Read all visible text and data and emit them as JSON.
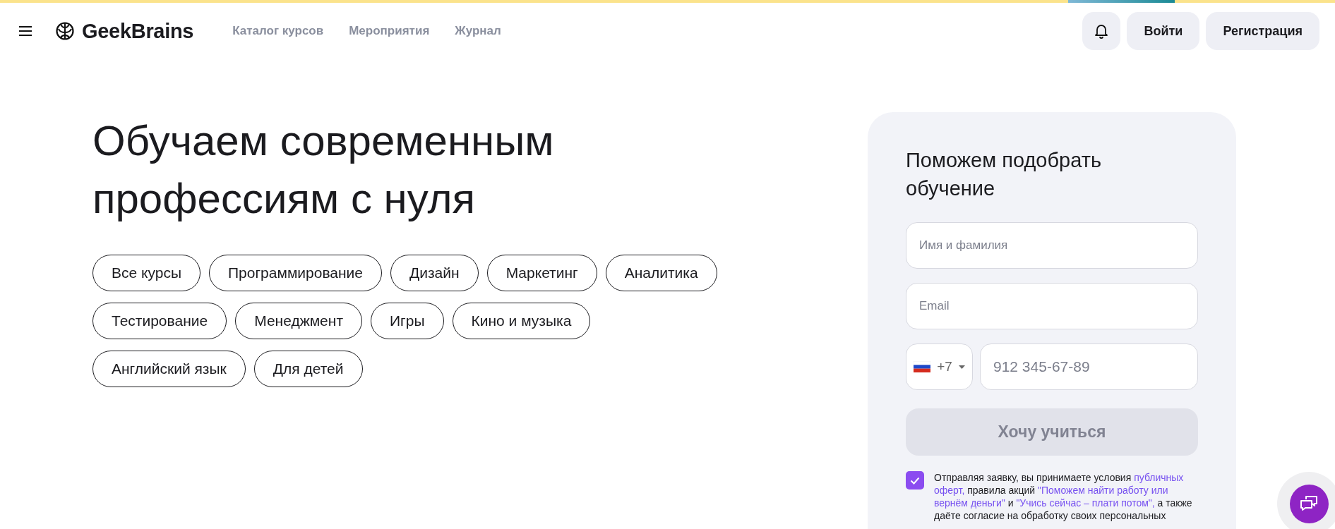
{
  "header": {
    "logo": "GeekBrains",
    "nav": [
      "Каталог курсов",
      "Мероприятия",
      "Журнал"
    ],
    "buttons": [
      "Войти",
      "Регистрация"
    ]
  },
  "hero": {
    "title": "Обучаем современным профессиям с нуля",
    "chips": [
      {
        "label": "Все курсы"
      },
      {
        "label": "Программирование"
      },
      {
        "label": "Дизайн"
      },
      {
        "label": "Маркетинг"
      },
      {
        "label": "Аналитика"
      },
      {
        "label": "Тестирование"
      },
      {
        "label": "Менеджмент"
      },
      {
        "label": "Игры"
      },
      {
        "label": "Кино и музыка"
      },
      {
        "label": "Английский язык"
      },
      {
        "label": "Для детей"
      }
    ]
  },
  "form": {
    "title": "Поможем подобрать обучение",
    "name_field": {
      "placeholder": "Имя и фамилия"
    },
    "email_field": {
      "placeholder": "Email"
    },
    "phone_code": "+7",
    "phone_field": {
      "placeholder": "912 345-67-89"
    },
    "submit": {
      "label": "Хочу учиться",
      "disabled": true
    },
    "consent": {
      "checked": true,
      "parts": [
        {
          "kind": "text",
          "text": "Отправляя заявку, вы принимаете условия "
        },
        {
          "kind": "link",
          "text": "публичных оферт,"
        },
        {
          "kind": "text",
          "text": " правила акций "
        },
        {
          "kind": "link",
          "text": "\"Поможем найти работу или вернём деньги\""
        },
        {
          "kind": "text",
          "text": " и "
        },
        {
          "kind": "link",
          "text": "\"Учись сейчас – плати потом\","
        },
        {
          "kind": "text",
          "text": " а также даёте согласие на обработку своих персональных"
        }
      ]
    }
  }
}
